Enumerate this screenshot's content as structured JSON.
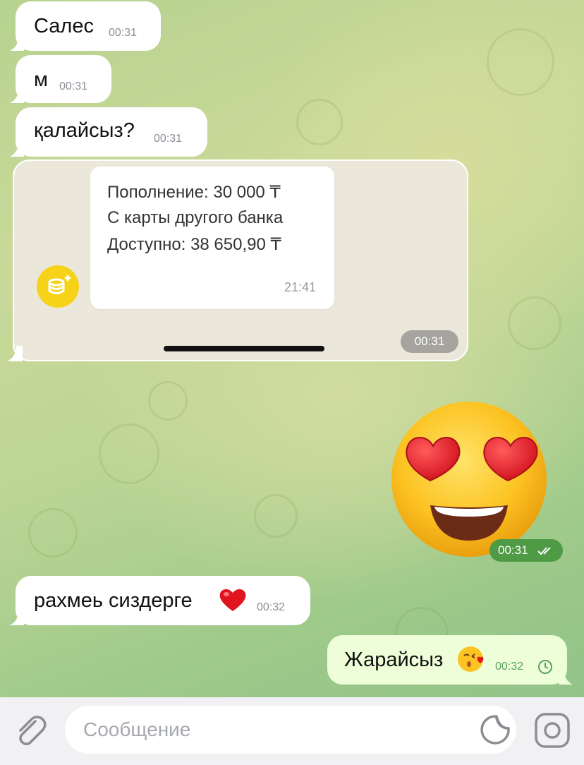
{
  "messages": [
    {
      "text": "Салес",
      "time": "00:31"
    },
    {
      "text": "м",
      "time": "00:31"
    },
    {
      "text": "қалайсыз?",
      "time": "00:31"
    }
  ],
  "forwarded_screenshot": {
    "lines": [
      "Пополнение: 30 000 ₸",
      "С карты другого банка",
      "Доступно: 38 650,90 ₸"
    ],
    "notification_time": "21:41",
    "icon": "coins-icon",
    "time": "00:31"
  },
  "sticker": {
    "emoji_name": "heart-eyes-emoji",
    "time": "00:31",
    "status": "read"
  },
  "reply_in": {
    "text": "рахмеь сиздерге",
    "emoji_name": "red-heart-emoji",
    "time": "00:32"
  },
  "reply_out": {
    "text": "Жарайсыз",
    "emoji_name": "kissing-heart-emoji",
    "time": "00:32",
    "status": "pending"
  },
  "composer": {
    "placeholder": "Сообщение"
  },
  "colors": {
    "incoming_bubble": "#ffffff",
    "outgoing_bubble": "#eefed8",
    "outgoing_time": "#5aa35b",
    "coin_icon": "#f6d218"
  }
}
